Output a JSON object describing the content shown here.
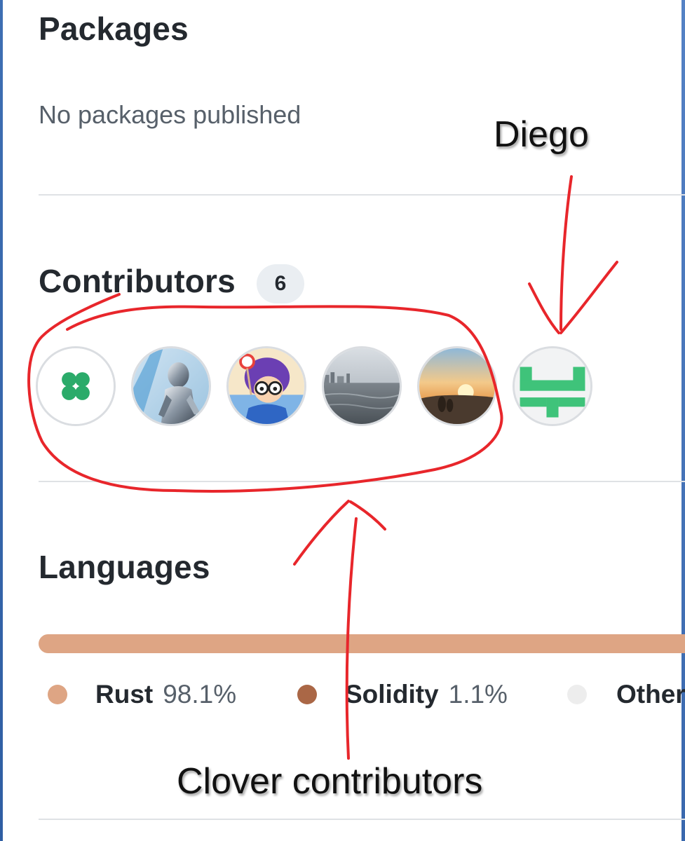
{
  "packages": {
    "title": "Packages",
    "empty_text": "No packages published"
  },
  "contributors": {
    "title": "Contributors",
    "count": "6",
    "avatars": [
      {
        "name": "clover-logo"
      },
      {
        "name": "silver-robot-photo"
      },
      {
        "name": "cartoon-girl-photo"
      },
      {
        "name": "sea-skyline-photo"
      },
      {
        "name": "sunset-photo"
      },
      {
        "name": "green-h-logo"
      }
    ]
  },
  "languages": {
    "title": "Languages",
    "items": [
      {
        "name": "Rust",
        "percent": "98.1%",
        "share": 0.981,
        "color": "#dea584"
      },
      {
        "name": "Solidity",
        "percent": "1.1%",
        "share": 0.011,
        "color": "#aa6746"
      },
      {
        "name": "Other",
        "percent": "",
        "share": 0.008,
        "color": "#ededed"
      }
    ]
  },
  "annotations": {
    "diego_label": "Diego",
    "clover_label": "Clover contributors",
    "color": "#e8262b"
  }
}
